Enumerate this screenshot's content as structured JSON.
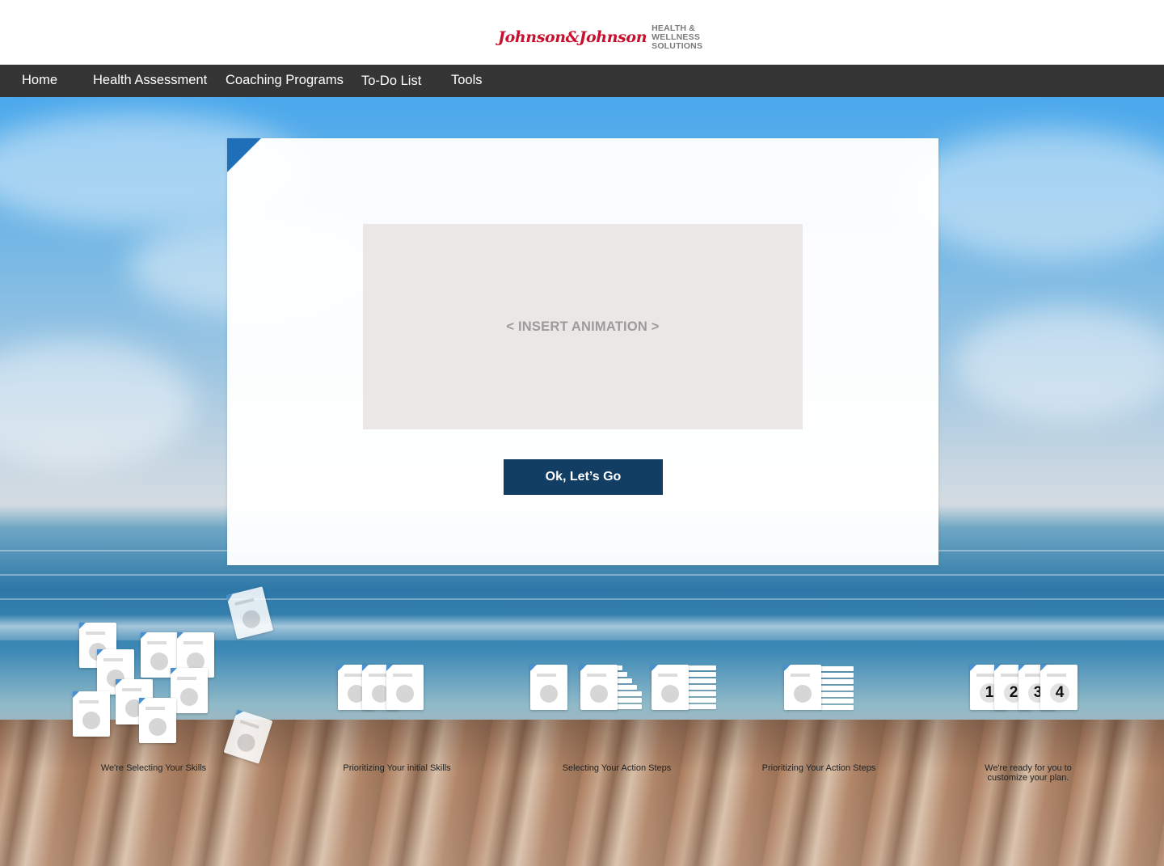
{
  "brand": {
    "logo_script": "Johnson&Johnson",
    "logo_sub_1": "HEALTH &",
    "logo_sub_2": "WELLNESS",
    "logo_sub_3": "SOLUTIONS",
    "colors": {
      "script": "#c8102e",
      "sub": "#7a7a7a"
    }
  },
  "nav": {
    "items": [
      {
        "label": "Home"
      },
      {
        "label": "Health Assessment"
      },
      {
        "label": "Coaching Programs"
      },
      {
        "label": "To-Do List"
      },
      {
        "label": "Tools"
      }
    ],
    "background": "#353535"
  },
  "card": {
    "placeholder": "< INSERT ANIMATION >",
    "button_label": "Ok, Let’s Go",
    "button_color": "#133e63",
    "corner_color": "#1f6fb8"
  },
  "steps": [
    {
      "label": "We're Selecting Your Skills"
    },
    {
      "label": "Prioritizing Your initial Skills"
    },
    {
      "label": "Selecting Your Action Steps"
    },
    {
      "label": "Prioritizing Your Action Steps"
    },
    {
      "label_line1": "We're ready for you to",
      "label_line2": "customize your plan."
    }
  ],
  "ranking_numbers": [
    "1",
    "2",
    "3",
    "4"
  ]
}
